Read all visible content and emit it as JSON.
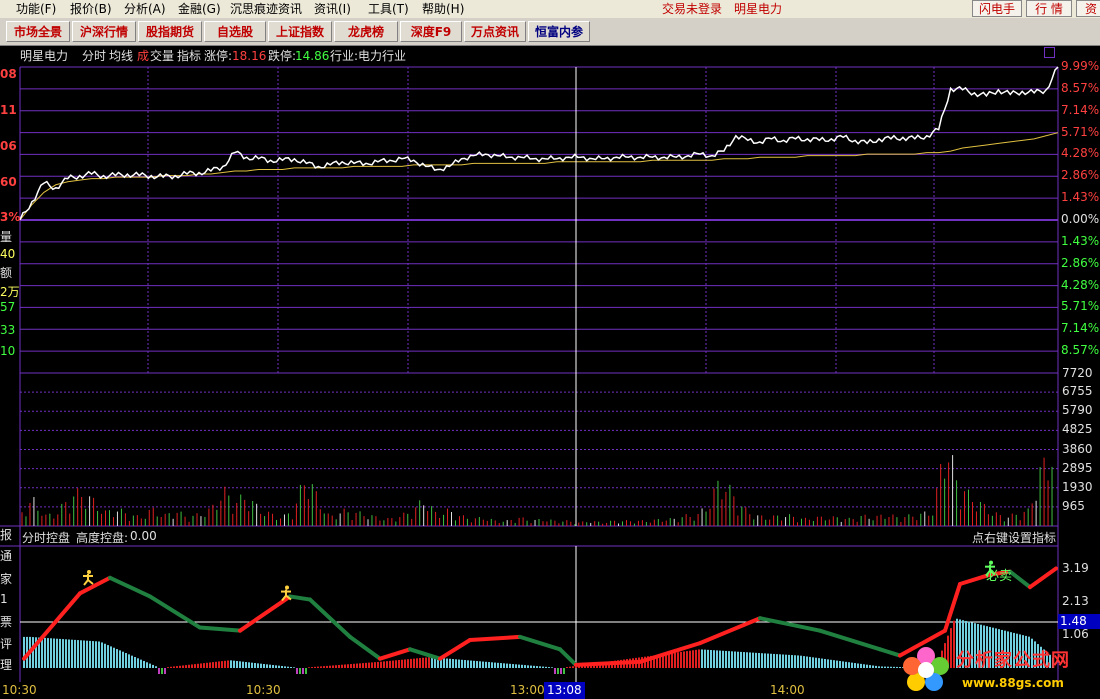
{
  "menu": [
    "功能(F)",
    "报价(B)",
    "分析(A)",
    "金融(G)",
    "沉思痕迹资讯",
    "资讯(I)",
    "工具(T)",
    "帮助(H)"
  ],
  "login_status": "交易未登录",
  "stock_name": "明星电力",
  "top_buttons": [
    "闪电手",
    "行 情",
    "资"
  ],
  "tabs": [
    "市场全景",
    "沪深行情",
    "股指期货",
    "自选股",
    "上证指数",
    "龙虎榜",
    "深度F9",
    "万点资讯",
    "恒富内参"
  ],
  "info": {
    "name": "明星电力",
    "fenshi": "分时",
    "junxian": "均线",
    "cheng": "成",
    "jiao": "交量",
    "zhibiao": "指标",
    "zhangting_label": "涨停:",
    "zhangting": "18.16",
    "dieting_label": "跌停:",
    "dieting": "14.86",
    "hangye_label": "行业:",
    "hangye": "电力行业"
  },
  "left_labels": [
    {
      "text": "08",
      "color": "#ff4040"
    },
    {
      "text": "11",
      "color": "#ff4040"
    },
    {
      "text": "06",
      "color": "#ff4040"
    },
    {
      "text": "60",
      "color": "#ff4040"
    },
    {
      "text": "3%",
      "color": "#ff4040"
    },
    {
      "text": "量",
      "color": "#e0e0e0"
    },
    {
      "text": "40",
      "color": "#ffff60"
    },
    {
      "text": "额",
      "color": "#e0e0e0"
    },
    {
      "text": "2万",
      "color": "#ffff60"
    },
    {
      "text": "57",
      "color": "#40ff40"
    },
    {
      "text": "33",
      "color": "#40ff40"
    },
    {
      "text": "10",
      "color": "#40ff40"
    }
  ],
  "left_labels_lower": [
    "报",
    "通",
    "家",
    "1",
    "票",
    "评",
    "理"
  ],
  "price_axis_up": [
    "9.99%",
    "8.57%",
    "7.14%",
    "5.71%",
    "4.28%",
    "2.86%",
    "1.43%"
  ],
  "price_axis_zero": "0.00%",
  "price_axis_down": [
    "1.43%",
    "2.86%",
    "4.28%",
    "5.71%",
    "7.14%",
    "8.57%"
  ],
  "volume_axis": [
    "7720",
    "6755",
    "5790",
    "4825",
    "3860",
    "2895",
    "1930",
    "965"
  ],
  "indicator": {
    "title": "分时控盘",
    "height_label": "高度控盘:",
    "height_value": "0.00",
    "right_hint": "点右键设置指标",
    "axis": [
      "3.19",
      "2.13",
      "1.06"
    ],
    "cursor_value": "1.48",
    "signal_text": "必卖"
  },
  "time_axis": [
    "10:30",
    "10:30",
    "13:00",
    "13:08",
    "14:00"
  ],
  "watermark": {
    "text": "分析家公式网",
    "url": "www.88gs.com"
  },
  "chart_data": {
    "type": "line",
    "price_pct": [
      0.0,
      1.2,
      2.4,
      2.1,
      2.7,
      2.9,
      3.0,
      2.9,
      2.9,
      3.0,
      2.9,
      2.9,
      2.8,
      2.9,
      3.0,
      3.1,
      3.2,
      3.5,
      4.4,
      4.1,
      4.0,
      3.9,
      3.9,
      4.0,
      3.7,
      3.5,
      3.6,
      3.8,
      3.7,
      3.7,
      3.8,
      3.9,
      4.0,
      3.9,
      3.5,
      3.3,
      3.5,
      4.0,
      4.2,
      4.3,
      4.2,
      4.1,
      4.1,
      4.0,
      4.0,
      4.0,
      4.1,
      4.1,
      4.0,
      4.0,
      4.1,
      4.1,
      4.1,
      4.1,
      4.1,
      4.1,
      4.2,
      4.3,
      4.2,
      4.5,
      5.5,
      5.2,
      5.1,
      5.3,
      5.2,
      5.3,
      5.3,
      5.2,
      5.3,
      5.4,
      5.2,
      5.0,
      5.3,
      5.3,
      5.4,
      5.3,
      5.5,
      5.9,
      8.6,
      8.5,
      8.3,
      8.1,
      8.5,
      8.2,
      8.4,
      8.3,
      8.5,
      9.99
    ],
    "avg_pct": [
      0.0,
      1.0,
      1.8,
      2.3,
      2.5,
      2.6,
      2.7,
      2.7,
      2.8,
      2.8,
      2.8,
      2.8,
      2.9,
      2.9,
      2.9,
      3.0,
      3.0,
      3.1,
      3.2,
      3.2,
      3.3,
      3.3,
      3.3,
      3.4,
      3.4,
      3.4,
      3.4,
      3.4,
      3.5,
      3.5,
      3.5,
      3.5,
      3.5,
      3.6,
      3.6,
      3.6,
      3.6,
      3.6,
      3.7,
      3.7,
      3.7,
      3.7,
      3.7,
      3.7,
      3.7,
      3.8,
      3.8,
      3.8,
      3.8,
      3.8,
      3.8,
      3.8,
      3.8,
      3.9,
      3.9,
      3.9,
      3.9,
      3.9,
      3.9,
      4.0,
      4.0,
      4.0,
      4.1,
      4.1,
      4.1,
      4.1,
      4.2,
      4.2,
      4.2,
      4.2,
      4.2,
      4.3,
      4.3,
      4.3,
      4.3,
      4.3,
      4.4,
      4.4,
      4.5,
      4.7,
      4.8,
      4.9,
      5.0,
      5.1,
      5.2,
      5.3,
      5.5,
      5.7
    ],
    "ylim_pct": [
      -9.99,
      9.99
    ],
    "volume_max": 7720,
    "volume_samples": [
      900,
      1500,
      600,
      800,
      1700,
      2000,
      1500,
      800,
      1000,
      700,
      500,
      1000,
      600,
      900,
      500,
      700,
      1000,
      2100,
      1400,
      1800,
      1000,
      700,
      500,
      1000,
      3100,
      1600,
      500,
      900,
      800,
      700,
      500,
      400,
      600,
      900,
      1600,
      700,
      900,
      600,
      400,
      500,
      300,
      300,
      500,
      300,
      400,
      300,
      300,
      200,
      300,
      200,
      300,
      300,
      300,
      300,
      400,
      400,
      600,
      600,
      1300,
      2800,
      1900,
      1000,
      600,
      500,
      600,
      600,
      400,
      500,
      500,
      500,
      400,
      600,
      500,
      700,
      500,
      600,
      700,
      900,
      5100,
      2600,
      1800,
      1300,
      800,
      500,
      700,
      900,
      3200,
      4500
    ]
  }
}
